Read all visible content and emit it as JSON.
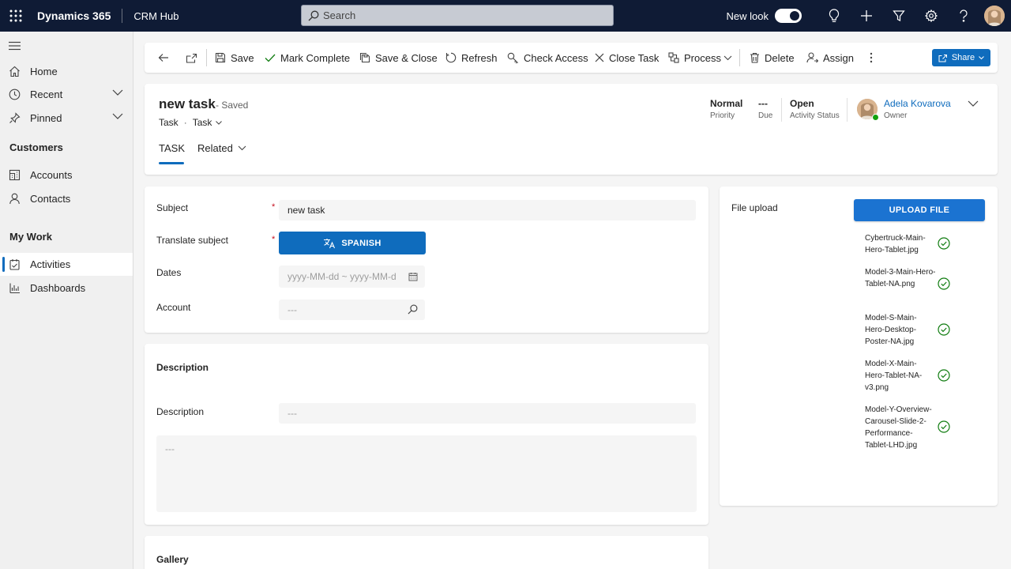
{
  "topbar": {
    "app_name": "Dynamics 365",
    "module": "CRM Hub",
    "search_placeholder": "Search",
    "new_look_label": "New look"
  },
  "sidebar": {
    "items": [
      {
        "label": "Home",
        "icon": "home-icon"
      },
      {
        "label": "Recent",
        "icon": "clock-icon"
      },
      {
        "label": "Pinned",
        "icon": "pin-icon"
      }
    ],
    "sections": [
      {
        "title": "Customers",
        "items": [
          {
            "label": "Accounts",
            "icon": "accounts-icon"
          },
          {
            "label": "Contacts",
            "icon": "contact-icon"
          }
        ]
      },
      {
        "title": "My Work",
        "items": [
          {
            "label": "Activities",
            "icon": "activities-icon",
            "active": true
          },
          {
            "label": "Dashboards",
            "icon": "dashboard-icon"
          }
        ]
      }
    ]
  },
  "commands": {
    "save": "Save",
    "mark_complete": "Mark Complete",
    "save_close": "Save & Close",
    "refresh": "Refresh",
    "check_access": "Check Access",
    "close_task": "Close Task",
    "process": "Process",
    "delete": "Delete",
    "assign": "Assign",
    "share": "Share"
  },
  "record": {
    "title": "new task",
    "status_suffix": "- Saved",
    "entity": "Task",
    "form": "Task",
    "priority_value": "Normal",
    "priority_label": "Priority",
    "due_value": "---",
    "due_label": "Due",
    "status_value": "Open",
    "status_label": "Activity Status",
    "owner_name": "Adela Kovarova",
    "owner_label": "Owner",
    "tabs": {
      "task": "TASK",
      "related": "Related"
    }
  },
  "form": {
    "subject_label": "Subject",
    "subject_value": "new task",
    "translate_label": "Translate subject",
    "translate_button": "SPANISH",
    "dates_label": "Dates",
    "dates_placeholder": "yyyy-MM-dd ~ yyyy-MM-d",
    "account_label": "Account",
    "account_placeholder": "---",
    "description_heading": "Description",
    "description_label": "Description",
    "description_placeholder": "---",
    "description_text_placeholder": "---",
    "gallery_heading": "Gallery"
  },
  "files": {
    "label": "File upload",
    "button": "UPLOAD FILE",
    "items": [
      "Cybertruck-Main-Hero-Tablet.jpg",
      "Model-3-Main-Hero-Tablet-NA.png",
      "Model-S-Main-Hero-Desktop-Poster-NA.jpg",
      "Model-X-Main-Hero-Tablet-NA-v3.png",
      "Model-Y-Overview-Carousel-Slide-2-Performance-Tablet-LHD.jpg"
    ]
  },
  "colors": {
    "topbar": "#0f1b35",
    "accent": "#0f6cbd",
    "success": "#107c10",
    "required": "#c50f1f"
  }
}
